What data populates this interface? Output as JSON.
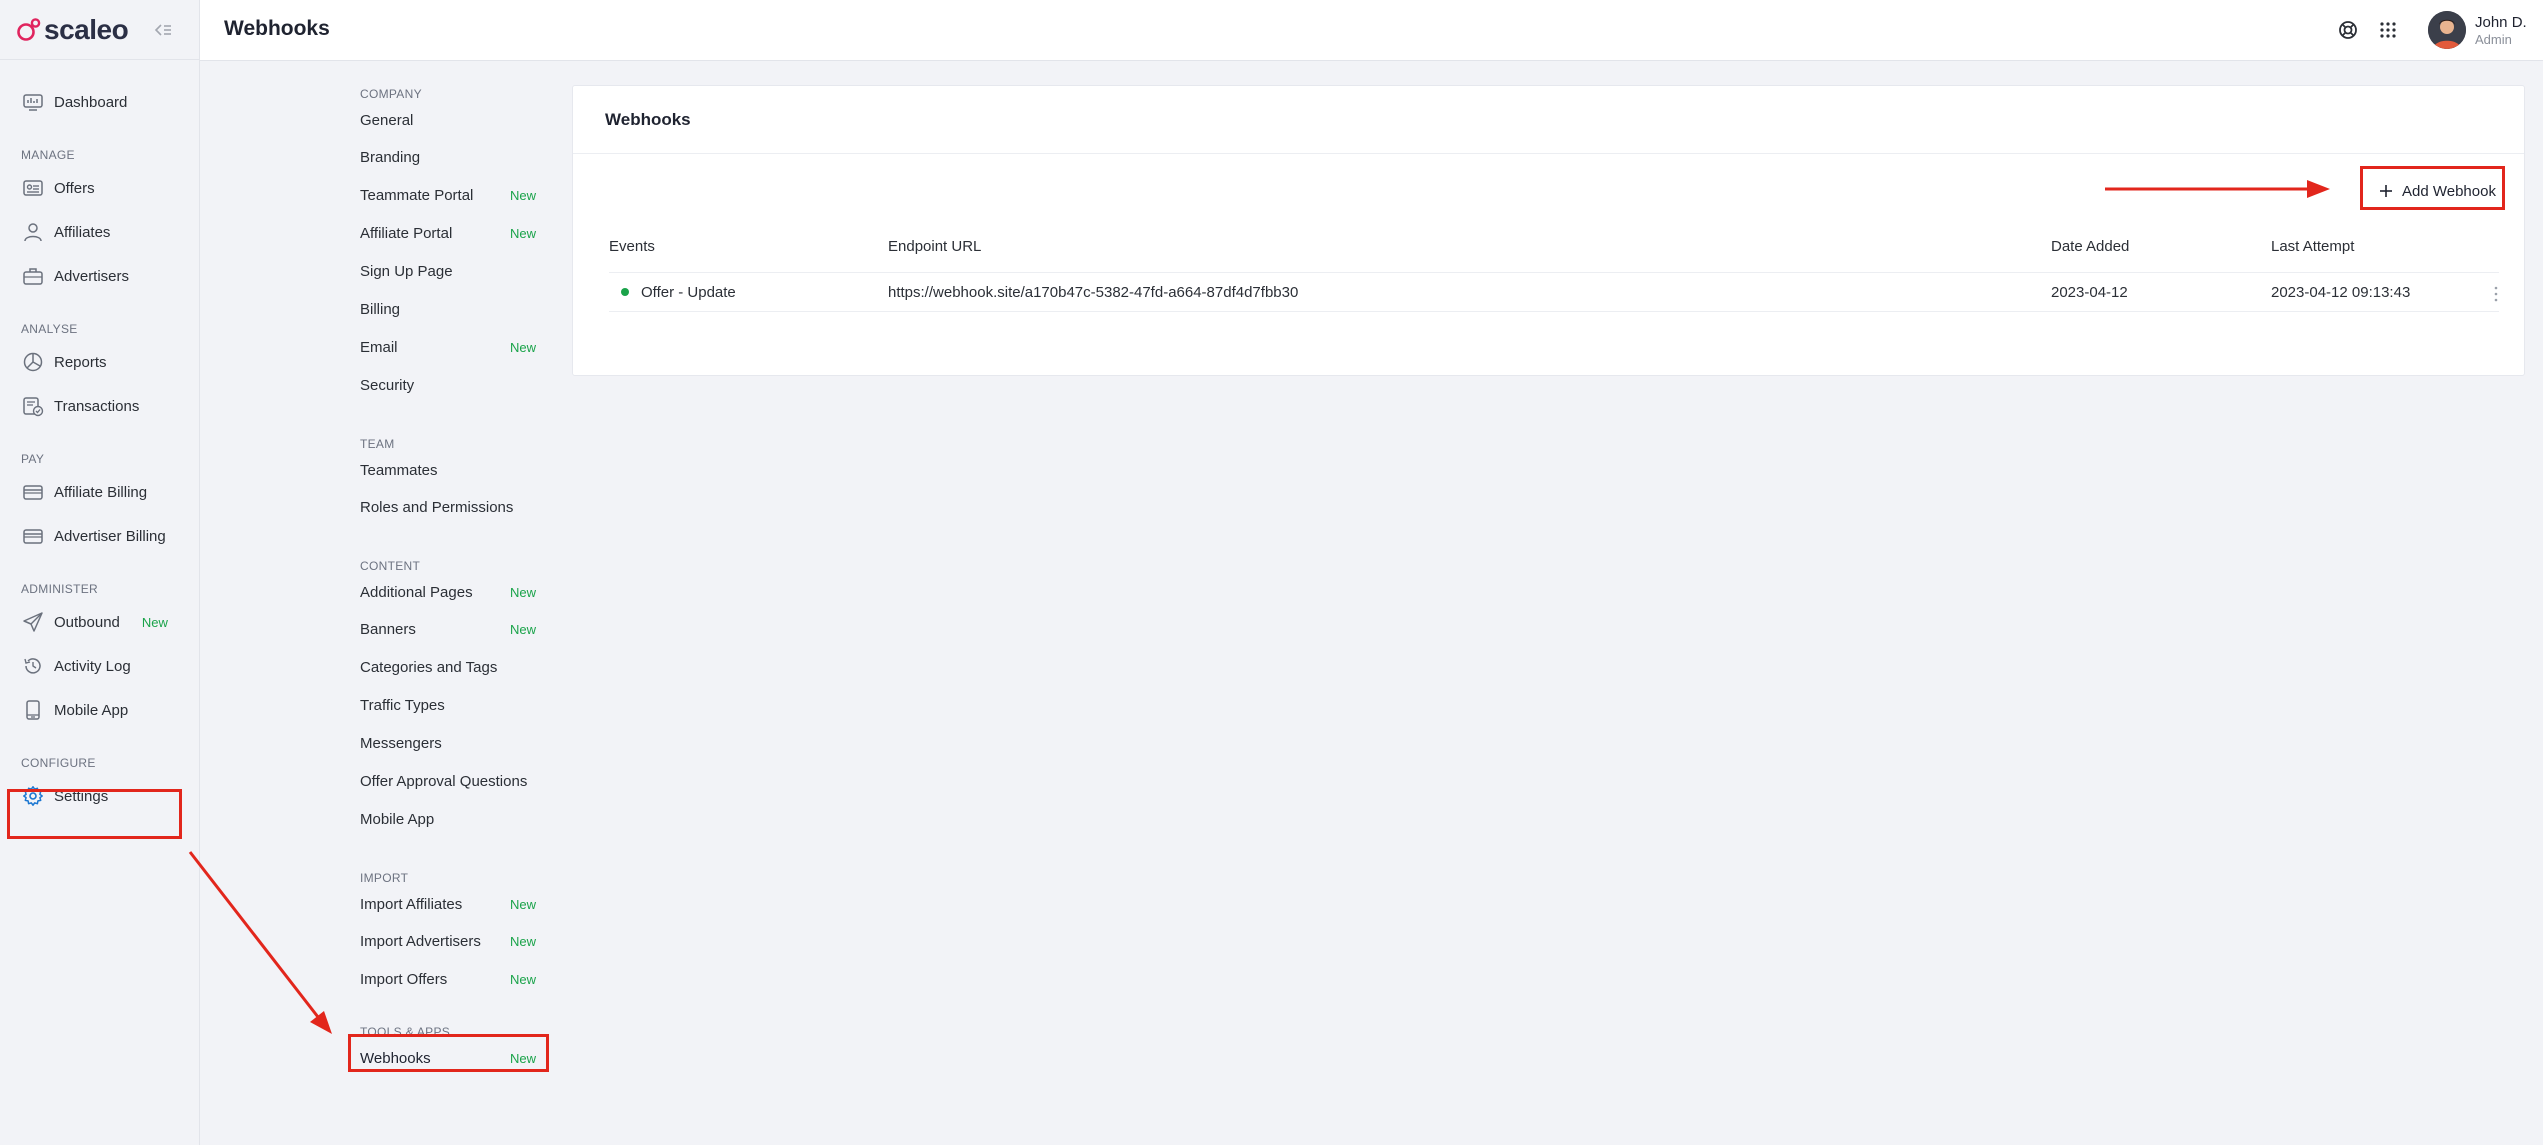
{
  "brand": {
    "name": "scaleo"
  },
  "header": {
    "title": "Webhooks",
    "user": {
      "name": "John D.",
      "role": "Admin"
    }
  },
  "sidebar": {
    "items_top": [
      {
        "label": "Dashboard",
        "icon": "dashboard-icon"
      }
    ],
    "sections": [
      {
        "label": "MANAGE",
        "items": [
          {
            "label": "Offers",
            "icon": "offers-icon"
          },
          {
            "label": "Affiliates",
            "icon": "user-icon"
          },
          {
            "label": "Advertisers",
            "icon": "briefcase-icon"
          }
        ]
      },
      {
        "label": "ANALYSE",
        "items": [
          {
            "label": "Reports",
            "icon": "pie-chart-icon"
          },
          {
            "label": "Transactions",
            "icon": "transactions-icon"
          }
        ]
      },
      {
        "label": "PAY",
        "items": [
          {
            "label": "Affiliate Billing",
            "icon": "card-icon"
          },
          {
            "label": "Advertiser Billing",
            "icon": "card-icon"
          }
        ]
      },
      {
        "label": "ADMINISTER",
        "items": [
          {
            "label": "Outbound",
            "icon": "paper-plane-icon",
            "badge": "New"
          },
          {
            "label": "Activity Log",
            "icon": "history-icon"
          },
          {
            "label": "Mobile App",
            "icon": "phone-icon"
          }
        ]
      },
      {
        "label": "CONFIGURE",
        "items": [
          {
            "label": "Settings",
            "icon": "gear-icon",
            "active": true
          }
        ]
      }
    ]
  },
  "submenu": {
    "sections": [
      {
        "label": "COMPANY",
        "items": [
          {
            "label": "General"
          },
          {
            "label": "Branding"
          },
          {
            "label": "Teammate Portal",
            "badge": "New"
          },
          {
            "label": "Affiliate Portal",
            "badge": "New"
          },
          {
            "label": "Sign Up Page"
          },
          {
            "label": "Billing"
          },
          {
            "label": "Email",
            "badge": "New"
          },
          {
            "label": "Security"
          }
        ]
      },
      {
        "label": "TEAM",
        "items": [
          {
            "label": "Teammates"
          },
          {
            "label": "Roles and Permissions"
          }
        ]
      },
      {
        "label": "CONTENT",
        "items": [
          {
            "label": "Additional Pages",
            "badge": "New"
          },
          {
            "label": "Banners",
            "badge": "New"
          },
          {
            "label": "Categories and Tags"
          },
          {
            "label": "Traffic Types"
          },
          {
            "label": "Messengers"
          },
          {
            "label": "Offer Approval Questions"
          },
          {
            "label": "Mobile App"
          }
        ]
      },
      {
        "label": "IMPORT",
        "items": [
          {
            "label": "Import Affiliates",
            "badge": "New"
          },
          {
            "label": "Import Advertisers",
            "badge": "New"
          },
          {
            "label": "Import Offers",
            "badge": "New"
          }
        ]
      },
      {
        "label": "TOOLS & APPS",
        "items": [
          {
            "label": "Webhooks",
            "badge": "New",
            "active": true
          }
        ]
      }
    ]
  },
  "card": {
    "title": "Webhooks",
    "add_button": "Add Webhook",
    "columns": [
      "Events",
      "Endpoint URL",
      "Date Added",
      "Last Attempt"
    ],
    "rows": [
      {
        "event": "Offer - Update",
        "endpoint": "https://webhook.site/a170b47c-5382-47fd-a664-87df4d7fbb30",
        "date_added": "2023-04-12",
        "last_attempt": "2023-04-12 09:13:43",
        "status_color": "#1aa34a"
      }
    ]
  },
  "colors": {
    "accent": "#e0245e",
    "new_badge": "#1aa34a",
    "annotation": "#e2261c",
    "settings_icon": "#1b76d1"
  }
}
